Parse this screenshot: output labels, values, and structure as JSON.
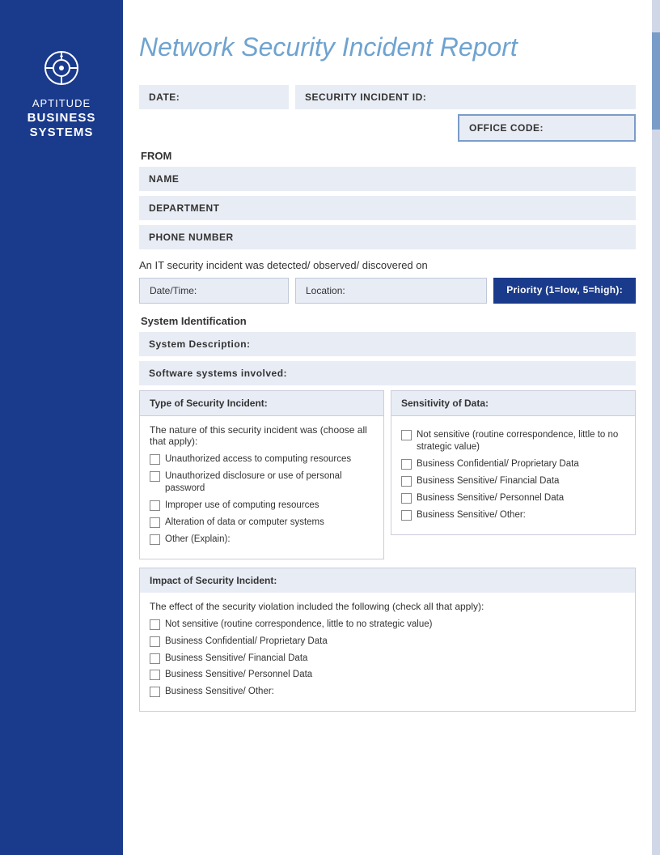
{
  "sidebar": {
    "icon_alt": "aptitude-logo-icon",
    "aptitude_label": "APTITUDE",
    "business_label": "BUSINESS\nSYSTEMS",
    "bg_color": "#1a3a8c"
  },
  "header": {
    "title": "Network Security Incident Report",
    "title_color": "#6fa3d0"
  },
  "form": {
    "date_label": "DATE:",
    "security_incident_id_label": "SECURITY INCIDENT ID:",
    "office_code_label": "OFFICE CODE:",
    "from_label": "FROM",
    "name_label": "NAME",
    "department_label": "DEPARTMENT",
    "phone_label": "PHONE NUMBER",
    "it_security_text": "An IT security incident was detected/ observed/ discovered on",
    "datetime_label": "Date/Time:",
    "location_label": "Location:",
    "priority_label": "Priority (1=low, 5=high):",
    "system_identification_label": "System Identification",
    "system_description_label": "System Description:",
    "software_systems_label": "Software systems involved:",
    "type_of_security_incident_label": "Type of Security Incident:",
    "sensitivity_of_data_label": "Sensitivity of Data:",
    "nature_subtitle": "The nature of this security incident was (choose all that apply):",
    "type_checkboxes": [
      "Unauthorized access to computing resources",
      "Unauthorized disclosure or use of personal password",
      "Improper use of computing resources",
      "Alteration of data or computer systems",
      "Other (Explain):"
    ],
    "sensitivity_checkboxes": [
      "Not sensitive (routine correspondence, little to no strategic value)",
      "Business Confidential/ Proprietary Data",
      "Business Sensitive/ Financial Data",
      "Business Sensitive/ Personnel Data",
      "Business Sensitive/ Other:"
    ],
    "impact_label": "Impact of Security Incident:",
    "effect_subtitle": "The effect of the security violation included the following (check all that apply):",
    "impact_checkboxes": [
      "Not sensitive (routine correspondence, little to no strategic value)",
      "Business Confidential/ Proprietary Data",
      "Business Sensitive/ Financial Data",
      "Business Sensitive/ Personnel Data",
      "Business Sensitive/ Other:"
    ]
  }
}
